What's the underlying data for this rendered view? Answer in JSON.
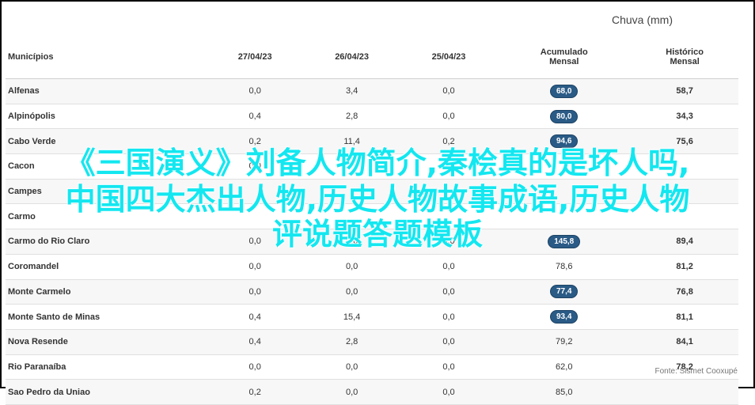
{
  "header": {
    "title": "Chuva (mm)"
  },
  "table": {
    "columns": [
      "Municípios",
      "27/04/23",
      "26/04/23",
      "25/04/23",
      "Acumulado\nMensal",
      "Histórico\nMensal"
    ],
    "rows": [
      [
        "Alfenas",
        "0,0",
        "3,4",
        "0,0",
        "68,0",
        "58,7"
      ],
      [
        "Alpinópolis",
        "0,4",
        "2,8",
        "0,0",
        "80,0",
        "34,3"
      ],
      [
        "Cabo Verde",
        "0,2",
        "11,4",
        "0,2",
        "94,6",
        "75,6"
      ],
      [
        "Cacon",
        "0,0",
        "",
        "",
        "",
        ""
      ],
      [
        "Campes",
        "",
        "",
        "",
        "",
        ""
      ],
      [
        "Carmo",
        "",
        "",
        "",
        "",
        ""
      ],
      [
        "Carmo do Rio Claro",
        "0,0",
        "0,0",
        "0,0",
        "145,8",
        "89,4"
      ],
      [
        "Coromandel",
        "0,0",
        "0,0",
        "0,0",
        "78,6",
        "81,2"
      ],
      [
        "Monte Carmelo",
        "0,0",
        "0,0",
        "0,0",
        "77,4",
        "76,8"
      ],
      [
        "Monte Santo de Minas",
        "0,4",
        "15,4",
        "0,0",
        "93,4",
        "81,1"
      ],
      [
        "Nova Resende",
        "0,4",
        "2,8",
        "0,0",
        "79,2",
        "84,1"
      ],
      [
        "Rio Paranaíba",
        "0,0",
        "0,0",
        "0,0",
        "62,0",
        "78,2"
      ],
      [
        "Sao Pedro da Uniao",
        "0,2",
        "0,0",
        "0,0",
        "85,0",
        ""
      ]
    ],
    "highlighted_accumulated": [
      true,
      true,
      true,
      true,
      false,
      false,
      true,
      false,
      true,
      true,
      false,
      false,
      false
    ]
  },
  "source": "Fonte: Sismet Cooxupé",
  "overlay": {
    "line1": "《三国演义》刘备人物简介,秦桧真的是坏人吗,",
    "line2": "中国四大杰出人物,历史人物故事成语,历史人物",
    "line3": "评说题答题模板"
  }
}
